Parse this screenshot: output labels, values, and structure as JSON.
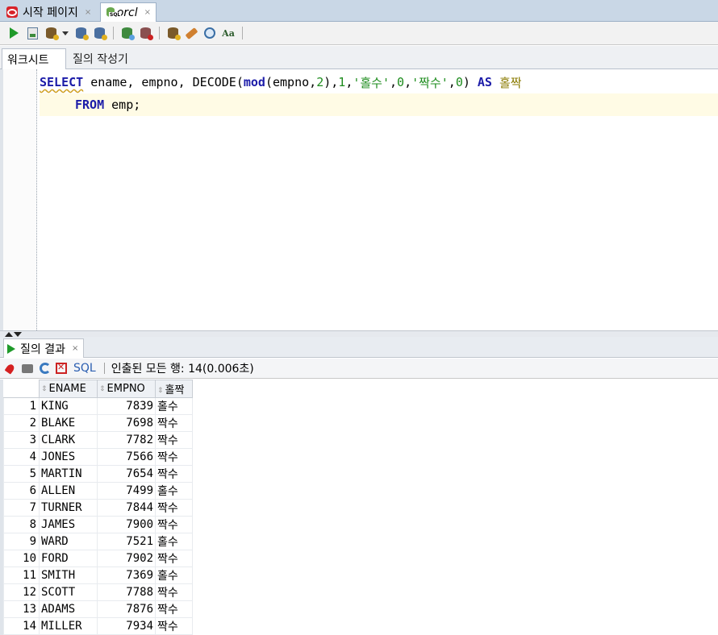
{
  "doc_tabs": [
    {
      "label": "시작 페이지",
      "close": "×"
    },
    {
      "label": "orcl",
      "close": "×"
    }
  ],
  "toolbar": {
    "icons": [
      "run-statement-icon",
      "run-script-icon",
      "commit-icon",
      "explain-plan-icon",
      "autotrace-icon",
      "rollback-icon",
      "sql-tuning-icon",
      "clear-icon",
      "history-icon",
      "format-icon"
    ]
  },
  "worksheet_tabs": [
    {
      "label": "워크시트"
    },
    {
      "label": "질의 작성기"
    }
  ],
  "editor": {
    "line1": {
      "select": "SELECT",
      "cols": " ename, empno, DECODE(",
      "mod": "mod",
      "mod_args": "(empno,",
      "n2": "2",
      "close1": "),",
      "n1": "1",
      "comma1": ",",
      "odd": "'홀수'",
      "comma2": ",",
      "n0a": "0",
      "comma3": ",",
      "even": "'짝수'",
      "comma4": ",",
      "n0b": "0",
      "close2": ") ",
      "as": "AS",
      "space": " ",
      "alias": "홀짝"
    },
    "line2": {
      "from": "FROM",
      "table": " emp;"
    }
  },
  "results": {
    "tab_label": "질의 결과",
    "close": "×",
    "sql_link": "SQL",
    "status": "인출된 모든 행: 14(0.006초)",
    "columns": [
      "ENAME",
      "EMPNO",
      "홀짝"
    ],
    "rows": [
      {
        "n": "1",
        "ename": "KING",
        "empno": "7839",
        "parity": "홀수"
      },
      {
        "n": "2",
        "ename": "BLAKE",
        "empno": "7698",
        "parity": "짝수"
      },
      {
        "n": "3",
        "ename": "CLARK",
        "empno": "7782",
        "parity": "짝수"
      },
      {
        "n": "4",
        "ename": "JONES",
        "empno": "7566",
        "parity": "짝수"
      },
      {
        "n": "5",
        "ename": "MARTIN",
        "empno": "7654",
        "parity": "짝수"
      },
      {
        "n": "6",
        "ename": "ALLEN",
        "empno": "7499",
        "parity": "홀수"
      },
      {
        "n": "7",
        "ename": "TURNER",
        "empno": "7844",
        "parity": "짝수"
      },
      {
        "n": "8",
        "ename": "JAMES",
        "empno": "7900",
        "parity": "짝수"
      },
      {
        "n": "9",
        "ename": "WARD",
        "empno": "7521",
        "parity": "홀수"
      },
      {
        "n": "10",
        "ename": "FORD",
        "empno": "7902",
        "parity": "짝수"
      },
      {
        "n": "11",
        "ename": "SMITH",
        "empno": "7369",
        "parity": "홀수"
      },
      {
        "n": "12",
        "ename": "SCOTT",
        "empno": "7788",
        "parity": "짝수"
      },
      {
        "n": "13",
        "ename": "ADAMS",
        "empno": "7876",
        "parity": "짝수"
      },
      {
        "n": "14",
        "ename": "MILLER",
        "empno": "7934",
        "parity": "짝수"
      }
    ]
  }
}
